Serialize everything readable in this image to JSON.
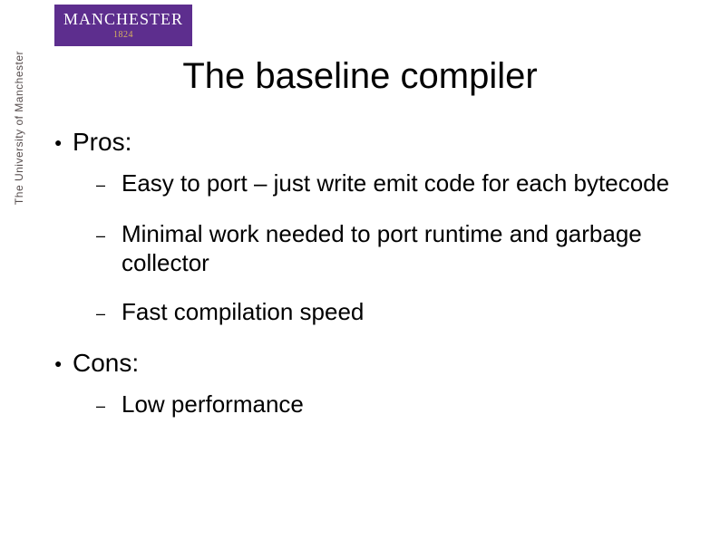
{
  "logo": {
    "main_a": "MANCH",
    "main_b": "EST",
    "main_c": "ER",
    "year": "1824"
  },
  "sidebar_text": "The University of Manchester",
  "title": "The baseline compiler",
  "bullets": [
    {
      "label": "Pros:",
      "subs": [
        "Easy to port – just write emit code for each bytecode",
        "Minimal work needed to port runtime and garbage collector",
        "Fast compilation speed"
      ]
    },
    {
      "label": "Cons:",
      "subs": [
        "Low performance"
      ]
    }
  ]
}
